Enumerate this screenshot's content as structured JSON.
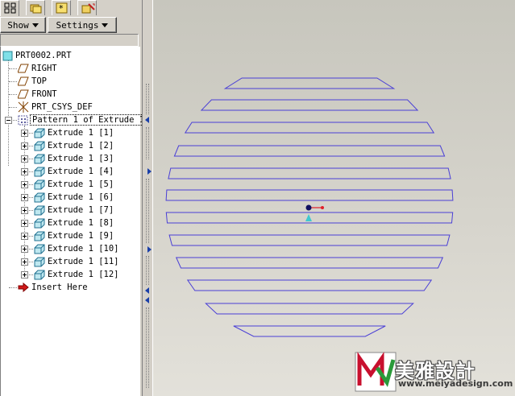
{
  "toolbar": {
    "show_label": "Show",
    "settings_label": "Settings"
  },
  "tabs": [
    {
      "icon": "model-tree-icon"
    },
    {
      "icon": "folder-browser-icon"
    },
    {
      "icon": "favorites-icon"
    },
    {
      "icon": "layer-icon"
    }
  ],
  "tree": {
    "root": "PRT0002.PRT",
    "datums": [
      "RIGHT",
      "TOP",
      "FRONT"
    ],
    "csys": "PRT_CSYS_DEF",
    "pattern": "Pattern 1 of Extrude 1",
    "members": [
      "Extrude 1 [1]",
      "Extrude 1 [2]",
      "Extrude 1 [3]",
      "Extrude 1 [4]",
      "Extrude 1 [5]",
      "Extrude 1 [6]",
      "Extrude 1 [7]",
      "Extrude 1 [8]",
      "Extrude 1 [9]",
      "Extrude 1 [10]",
      "Extrude 1 [11]",
      "Extrude 1 [12]"
    ],
    "insert": "Insert Here"
  },
  "watermark": {
    "brand": "美雅設計",
    "url": "www.meiyadesign.com"
  },
  "colors": {
    "sketch_line": "#4a3fd6",
    "csys_red": "#e0202a",
    "csys_cyan": "#40c8d0",
    "tree_bg": "#ffffff",
    "panel_bg": "#d4d0c8"
  }
}
